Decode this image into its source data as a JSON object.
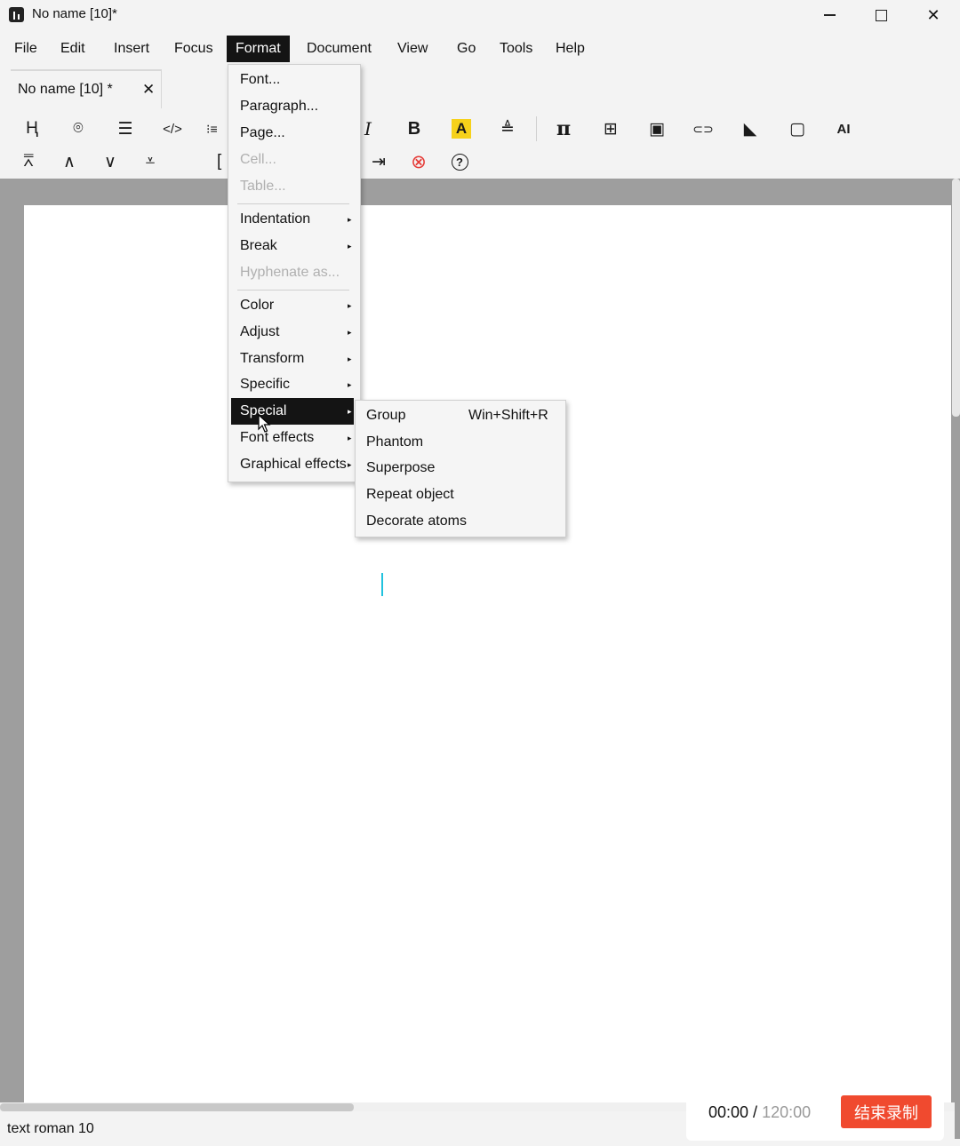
{
  "window": {
    "title": "No name [10]*",
    "controls": {
      "minimize": "minimize",
      "maximize": "maximize",
      "close": "✕"
    }
  },
  "menubar": {
    "items": [
      "File",
      "Edit",
      "Insert",
      "Focus",
      "Format",
      "Document",
      "View",
      "Go",
      "Tools",
      "Help"
    ],
    "active": "Format"
  },
  "tab": {
    "label": "No name [10] *",
    "close": "✕"
  },
  "toolbar": {
    "row1": [
      {
        "icon": "header-icon",
        "glyph": "Ⱨ"
      },
      {
        "icon": "location-icon",
        "glyph": "⌾"
      },
      {
        "icon": "list-icon",
        "glyph": "☰"
      },
      {
        "icon": "code-icon",
        "glyph": "</>"
      },
      {
        "icon": "outline-icon",
        "glyph": "⁝≡"
      },
      {
        "icon": "italic-icon",
        "glyph": "I"
      },
      {
        "icon": "bold-icon",
        "glyph": "B"
      },
      {
        "icon": "highlight-icon",
        "glyph": "A"
      },
      {
        "icon": "stamp-icon",
        "glyph": "≜"
      },
      {
        "icon": "pi-icon",
        "glyph": "π"
      },
      {
        "icon": "table-icon",
        "glyph": "⊞"
      },
      {
        "icon": "image-icon",
        "glyph": "▣"
      },
      {
        "icon": "link-icon",
        "glyph": "⊂⊃"
      },
      {
        "icon": "eraser-icon",
        "glyph": "◣"
      },
      {
        "icon": "terminal-icon",
        "glyph": "▢"
      },
      {
        "icon": "ai-icon",
        "glyph": "AI"
      }
    ],
    "row2": [
      {
        "icon": "first-icon",
        "glyph": "⩞"
      },
      {
        "icon": "previous-icon",
        "glyph": "∧"
      },
      {
        "icon": "next-icon",
        "glyph": "∨"
      },
      {
        "icon": "last-icon",
        "glyph": "⩡"
      },
      {
        "icon": "bracket-icon",
        "glyph": "["
      },
      {
        "icon": "export-icon",
        "glyph": "⇥"
      },
      {
        "icon": "stop-icon",
        "glyph": "⊗"
      },
      {
        "icon": "help-icon",
        "glyph": "?"
      }
    ]
  },
  "format_menu": {
    "items": [
      {
        "label": "Font...",
        "enabled": true
      },
      {
        "label": "Paragraph...",
        "enabled": true
      },
      {
        "label": "Page...",
        "enabled": true
      },
      {
        "label": "Cell...",
        "enabled": false
      },
      {
        "label": "Table...",
        "enabled": false
      },
      {
        "label": "Indentation",
        "enabled": true,
        "submenu": true
      },
      {
        "label": "Break",
        "enabled": true,
        "submenu": true
      },
      {
        "label": "Hyphenate as...",
        "enabled": false
      },
      {
        "label": "Color",
        "enabled": true,
        "submenu": true
      },
      {
        "label": "Adjust",
        "enabled": true,
        "submenu": true
      },
      {
        "label": "Transform",
        "enabled": true,
        "submenu": true
      },
      {
        "label": "Specific",
        "enabled": true,
        "submenu": true
      },
      {
        "label": "Special",
        "enabled": true,
        "submenu": true,
        "highlighted": true
      },
      {
        "label": "Font effects",
        "enabled": true,
        "submenu": true
      },
      {
        "label": "Graphical effects",
        "enabled": true,
        "submenu": true
      }
    ],
    "arrow": "▸"
  },
  "special_submenu": {
    "items": [
      {
        "label": "Group",
        "shortcut": "Win+Shift+R"
      },
      {
        "label": "Phantom",
        "shortcut": ""
      },
      {
        "label": "Superpose",
        "shortcut": ""
      },
      {
        "label": "Repeat object",
        "shortcut": ""
      },
      {
        "label": "Decorate atoms",
        "shortcut": ""
      }
    ]
  },
  "status": {
    "text": "text roman 10"
  },
  "recording": {
    "current": "00:00",
    "separator": " / ",
    "total": "120:00",
    "stop_label": "结束录制"
  },
  "colors": {
    "accent_menu": "#141414",
    "cursor": "#21c2de",
    "record_button": "#f04a2f",
    "highlight_yellow": "#f6d11a"
  }
}
